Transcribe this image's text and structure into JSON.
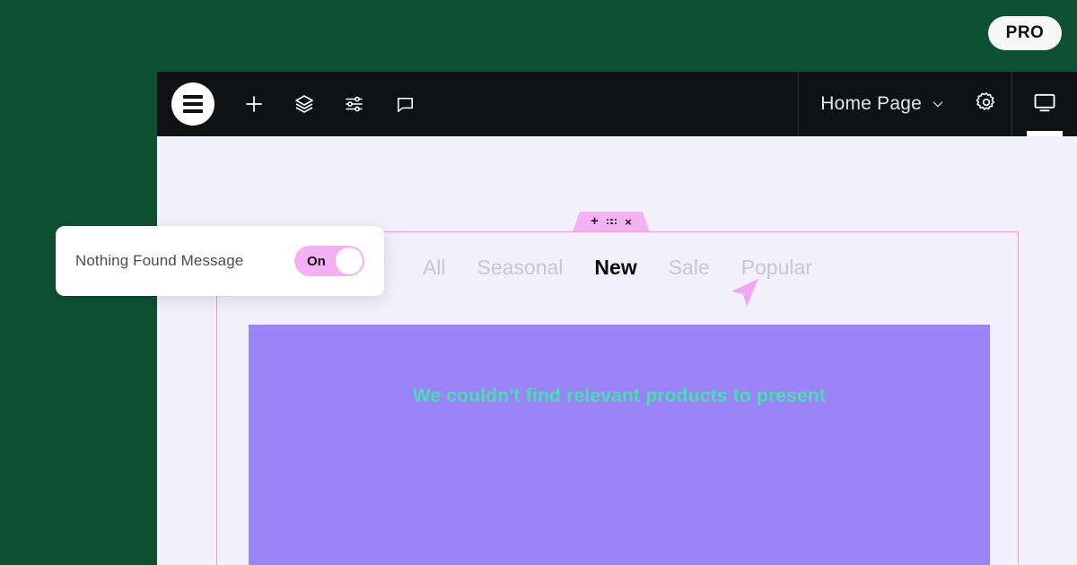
{
  "badge": {
    "label": "PRO",
    "name": "pro-badge"
  },
  "toolbar": {
    "menu_icon": "hamburger-menu-icon",
    "add_icon": "plus-icon",
    "layers_icon": "layers-icon",
    "settings_sliders_icon": "sliders-icon",
    "comments_icon": "comment-bubble-icon",
    "page_name": "Home Page",
    "page_chevron_icon": "chevron-down-icon",
    "gear_icon": "gear-icon",
    "device_icon": "desktop-monitor-icon"
  },
  "widget_handle": {
    "add_label": "+",
    "drag_icon": "drag-dots-icon",
    "close_label": "×"
  },
  "filters": {
    "items": [
      {
        "label": "All",
        "state": "dim"
      },
      {
        "label": "Seasonal",
        "state": "dim"
      },
      {
        "label": "New",
        "state": "active"
      },
      {
        "label": "Sale",
        "state": "dim"
      },
      {
        "label": "Popular",
        "state": "dim"
      }
    ]
  },
  "product_panel": {
    "nothing_found_message": "We couldn't find relevant products to present"
  },
  "setting_card": {
    "label": "Nothing Found Message",
    "toggle_value": "On"
  },
  "colors": {
    "background_green": "#0d5133",
    "topbar_black": "#101113",
    "canvas_lavender": "#f3f0fd",
    "accent_pink": "#f3b3f3",
    "outline_pink": "#ec9fe6",
    "panel_purple": "#9b84f7",
    "message_mint": "#45e0b0"
  }
}
